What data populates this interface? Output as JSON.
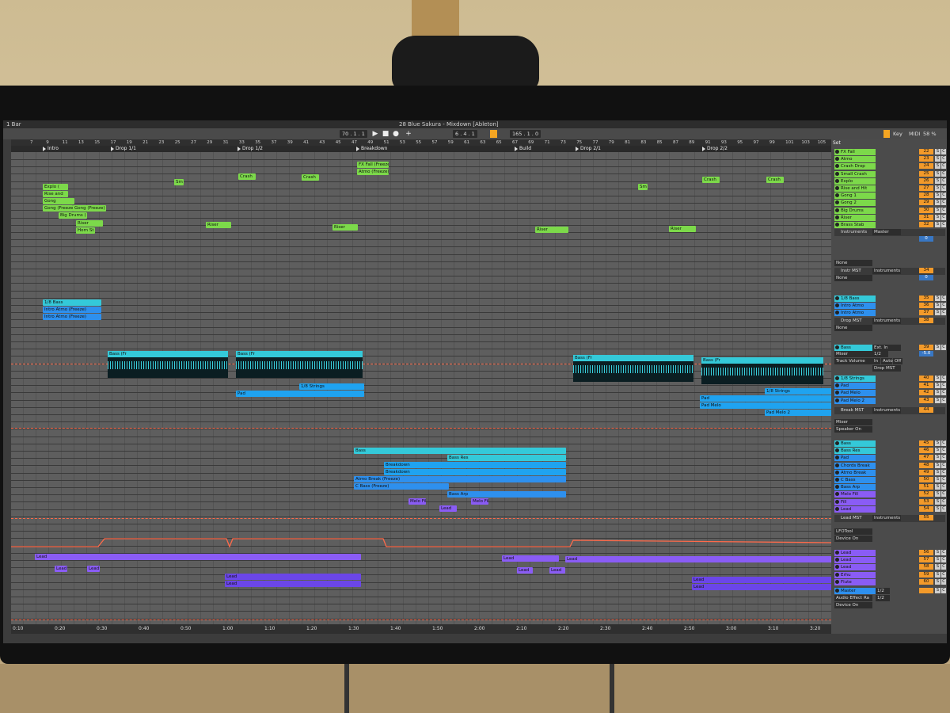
{
  "window": {
    "title": "28 Blue Sakura - Mixdown  [Ableton]",
    "bar_selector": "1 Bar"
  },
  "transport": {
    "tempo_left": "70 . 1 . 1",
    "position": "6 . 4 . 1",
    "loop_length": "165 . 1 . 0",
    "key_label": "Key",
    "midi_label": "MIDI",
    "cpu": "58 %"
  },
  "ruler_bars": [
    "7",
    "9",
    "11",
    "13",
    "15",
    "17",
    "19",
    "21",
    "23",
    "25",
    "27",
    "29",
    "31",
    "33",
    "35",
    "37",
    "39",
    "41",
    "43",
    "45",
    "47",
    "49",
    "51",
    "53",
    "55",
    "57",
    "59",
    "61",
    "63",
    "65",
    "67",
    "69",
    "71",
    "73",
    "75",
    "77",
    "79",
    "81",
    "83",
    "85",
    "87",
    "89",
    "91",
    "93",
    "95",
    "97",
    "99",
    "101",
    "103",
    "105"
  ],
  "locators": [
    {
      "label": "Intro"
    },
    {
      "label": "Drop 1/1"
    },
    {
      "label": "Drop 1/2"
    },
    {
      "label": "Breakdown"
    },
    {
      "label": "Build"
    },
    {
      "label": "Drop 2/1"
    },
    {
      "label": "Drop 2/2"
    }
  ],
  "time_ticks": [
    "0:10",
    "0:20",
    "0:30",
    "0:40",
    "0:50",
    "1:00",
    "1:10",
    "1:20",
    "1:30",
    "1:40",
    "1:50",
    "2:00",
    "2:10",
    "2:20",
    "2:30",
    "2:40",
    "2:50",
    "3:00",
    "3:10",
    "3:20"
  ],
  "clips": {
    "fx_fall": "FX Fall (Freeze)",
    "atmo_freeze": "Atmo (Freeze)",
    "crash": "Crash",
    "sm": "Sm",
    "explo": "Explo (",
    "rise_and": "Rise and",
    "gong": "Gong",
    "gong_freeze": "Gong (Freeze)",
    "big_drums": "Big Drums (",
    "riser": "Riser",
    "horn": "Horn St",
    "bass18": "1/8 Bass",
    "intro_atmo": "Intro Atmo (Freeze)",
    "bass_freeze": "Bass (Fr",
    "strings18": "1/8 Strings",
    "pad": "Pad",
    "pad_melo": "Pad Melo",
    "pad_melo2": "Pad Melo 2",
    "bass": "Bass",
    "bass_res": "Bass Res",
    "breakdown": "Breakdown",
    "atmo_break": "Atmo Break (Freeze)",
    "c_bass": "C Bass (Freeze)",
    "bass_arp": "Bass Arp",
    "melo_fill": "Melo Fill",
    "lead": "Lead"
  },
  "mixer": {
    "set_label": "Set",
    "fx_tracks": [
      {
        "name": "FX Fall",
        "num": "22"
      },
      {
        "name": "Atmo",
        "num": "23"
      },
      {
        "name": "Crash Drop",
        "num": "24"
      },
      {
        "name": "Small Crash",
        "num": "25"
      },
      {
        "name": "Explo",
        "num": "26"
      },
      {
        "name": "Rise and Hit",
        "num": "27"
      },
      {
        "name": "Gong 1",
        "num": "28"
      },
      {
        "name": "Gong 2",
        "num": "29"
      },
      {
        "name": "Big Drums",
        "num": "30"
      },
      {
        "name": "Riser",
        "num": "31"
      },
      {
        "name": "Brass Stab",
        "num": "32"
      }
    ],
    "instruments_group": "Instruments",
    "master_label": "Master",
    "none_label": "None",
    "zero": "0",
    "c": "C",
    "s": "S",
    "instr_mst": {
      "name": "Instr MST",
      "route": "Instruments",
      "num": "34"
    },
    "intro_tracks": [
      {
        "name": "1/8 Bass",
        "num": "35"
      },
      {
        "name": "Intro Atmo",
        "num": "36"
      },
      {
        "name": "Intro Atmo",
        "num": "37"
      }
    ],
    "drop_mst": {
      "name": "Drop MST",
      "route": "Instruments",
      "num": "38"
    },
    "bass_track": {
      "name": "Bass",
      "num": "39",
      "input": "Ext. In",
      "mixer": "Mixer",
      "track_volume": "Track Volume",
      "half": "1/2",
      "vol": "-5.0",
      "in": "In",
      "auto": "Auto",
      "off": "Off",
      "drop_mst_sel": "Drop MST"
    },
    "drop_tracks": [
      {
        "name": "1/8 Strings",
        "num": "40"
      },
      {
        "name": "Pad",
        "num": "41"
      },
      {
        "name": "Pad Melo",
        "num": "42"
      },
      {
        "name": "Pad Melo 2",
        "num": "43"
      }
    ],
    "break_mst": {
      "name": "Break MST",
      "route": "Instruments",
      "num": "44",
      "speaker": "Speaker On"
    },
    "break_tracks": [
      {
        "name": "Bass",
        "num": "45"
      },
      {
        "name": "Bass Res",
        "num": "46"
      },
      {
        "name": "Pad",
        "num": "47"
      },
      {
        "name": "Chords Break",
        "num": "48"
      },
      {
        "name": "Atmo Break",
        "num": "49"
      },
      {
        "name": "C Bass",
        "num": "50"
      },
      {
        "name": "Bass Arp",
        "num": "51"
      },
      {
        "name": "Melo Fill",
        "num": "52"
      },
      {
        "name": "Fill",
        "num": "53"
      },
      {
        "name": "Lead",
        "num": "54"
      }
    ],
    "lead_mst": {
      "name": "Lead MST",
      "route": "Instruments",
      "num": "55",
      "lfo": "LFOTool",
      "device": "Device On"
    },
    "lead_tracks": [
      {
        "name": "Lead",
        "num": "56"
      },
      {
        "name": "Lead",
        "num": "57"
      },
      {
        "name": "Lead",
        "num": "58"
      },
      {
        "name": "Erhu",
        "num": "59"
      },
      {
        "name": "Flute",
        "num": "60"
      }
    ],
    "master": {
      "name": "Master",
      "sub1": "Audio Effect Ra",
      "sub2": "Device On",
      "half": "1/2",
      "zero": "0"
    }
  },
  "colors": {
    "orange": "#f39a2a",
    "green": "#7cd94a",
    "cyan": "#34c9d9",
    "blue": "#2e90ee",
    "purple": "#8a5cf5",
    "automation": "#ff6a4a"
  }
}
